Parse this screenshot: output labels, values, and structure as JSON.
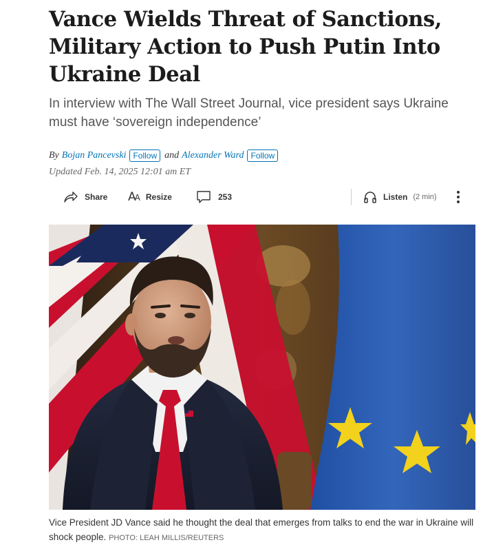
{
  "article": {
    "headline": "Vance Wields Threat of Sanctions, Military Action to Push Putin Into Ukraine Deal",
    "dek": "In interview with The Wall Street Journal, vice president says Ukraine must have ‘sovereign independence’",
    "byline": {
      "by": "By",
      "author1": "Bojan Pancevski",
      "and": "and",
      "author2": "Alexander Ward",
      "follow_label": "Follow"
    },
    "timestamp": "Updated Feb. 14, 2025 12:01 am ET"
  },
  "toolbar": {
    "share_label": "Share",
    "resize_label": "Resize",
    "comment_count": "253",
    "listen_label": "Listen",
    "listen_duration": "(2 min)"
  },
  "photo": {
    "caption": "Vice President JD Vance said he thought the deal that emerges from talks to end the war in Ukraine will shock people.",
    "credit": "PHOTO: LEAH MILLIS/REUTERS"
  },
  "colors": {
    "link": "#0274b6",
    "headline": "#1c1c1c",
    "dek": "#555555",
    "eu_blue": "#2a56a8",
    "eu_star": "#f2d21c",
    "flag_red": "#c8102e"
  },
  "icons": [
    "share-icon",
    "resize-icon",
    "comment-icon",
    "headphones-icon",
    "more-vertical-icon"
  ]
}
